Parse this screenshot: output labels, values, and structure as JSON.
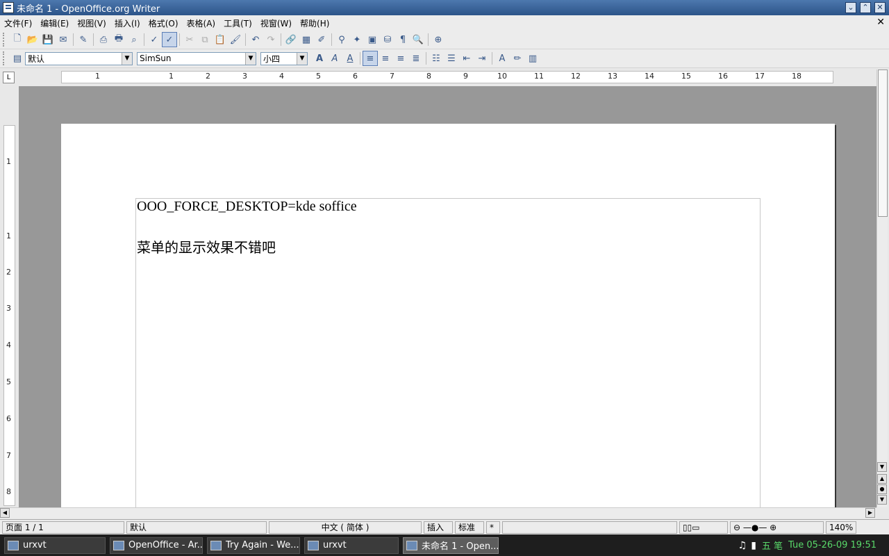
{
  "window": {
    "title": "未命名  1 - OpenOffice.org Writer",
    "min": "⌄",
    "max": "⌃",
    "close": "✕"
  },
  "menu": [
    "文件(F)",
    "编辑(E)",
    "视图(V)",
    "插入(I)",
    "格式(O)",
    "表格(A)",
    "工具(T)",
    "视窗(W)",
    "帮助(H)"
  ],
  "menu_close": "✕",
  "toolbar": {
    "style": "默认",
    "font": "SimSun",
    "size": "小四"
  },
  "ruler": {
    "h_numbers": [
      "1",
      "1",
      "2",
      "3",
      "4",
      "5",
      "6",
      "7",
      "8",
      "9",
      "10",
      "11",
      "12",
      "13",
      "14",
      "15",
      "16",
      "17",
      "18"
    ],
    "v_numbers": [
      "1",
      "1",
      "2",
      "3",
      "4",
      "5",
      "6",
      "7",
      "8"
    ]
  },
  "document": {
    "line1": "OOO_FORCE_DESKTOP=kde soffice",
    "line2": "菜单的显示效果不错吧"
  },
  "status": {
    "page": "页面 1 / 1",
    "style": "默认",
    "lang": "中文 ( 简体 )",
    "insert": "插入",
    "mode": "标准",
    "star": "*",
    "zoom": "140%"
  },
  "taskbar": {
    "tasks": [
      "urxvt",
      "OpenOffice - Ar...",
      "Try Again - We...",
      "urxvt",
      "未命名 1 - Open..."
    ],
    "clock": "Tue 05-26-09 19:51",
    "ime": "五 笔"
  }
}
